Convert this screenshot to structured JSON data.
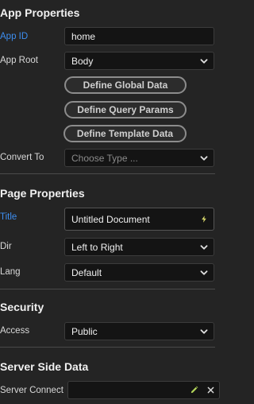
{
  "app_properties": {
    "title": "App Properties",
    "app_id_label": "App ID",
    "app_id_value": "home",
    "app_root_label": "App Root",
    "app_root_value": "Body",
    "define_global_data": "Define Global Data",
    "define_query_params": "Define Query Params",
    "define_template_data": "Define Template Data",
    "convert_to_label": "Convert To",
    "convert_to_placeholder": "Choose Type ..."
  },
  "page_properties": {
    "title": "Page Properties",
    "title_label": "Title",
    "title_value": "Untitled Document",
    "dir_label": "Dir",
    "dir_value": "Left to Right",
    "lang_label": "Lang",
    "lang_value": "Default"
  },
  "security": {
    "title": "Security",
    "access_label": "Access",
    "access_value": "Public"
  },
  "server_side_data": {
    "title": "Server Side Data",
    "server_connect_label": "Server Connect",
    "server_connect_value": ""
  },
  "colors": {
    "background": "#242424",
    "field_background": "#141414",
    "accent_blue": "#3d8ef0",
    "lightning_yellow": "#d6d66a",
    "pencil_green": "#b3d65a"
  },
  "icons": {
    "dropdown": "chevron-down-icon",
    "lightning": "lightning-icon",
    "edit": "pencil-icon",
    "clear": "close-icon"
  }
}
